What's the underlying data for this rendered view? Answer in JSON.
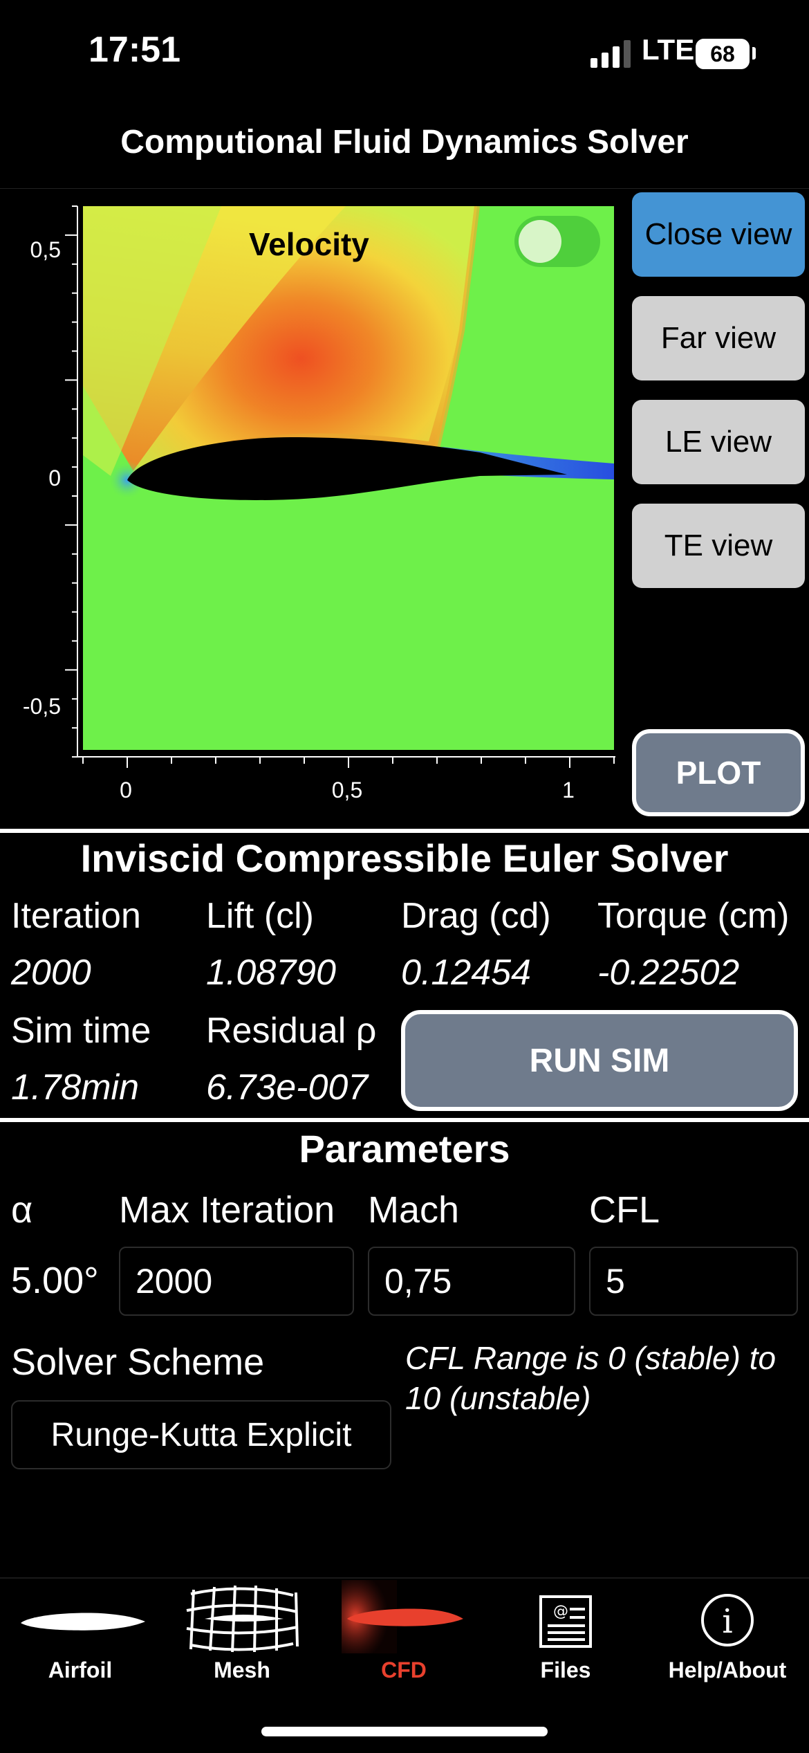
{
  "status": {
    "time": "17:51",
    "network": "LTE",
    "battery": "68"
  },
  "title": "Computional Fluid Dynamics Solver",
  "plot": {
    "label": "Velocity",
    "y_ticks": [
      "0,5",
      "0",
      "-0,5"
    ],
    "x_ticks": [
      "0",
      "0,5",
      "1"
    ],
    "toggle_on": true,
    "colors": {
      "field": "#6ef04a",
      "high": "#ef3b1e",
      "mid": "#f6d52e",
      "low": "#1f3cf0",
      "airfoil": "#000000"
    }
  },
  "view_buttons": [
    {
      "label": "Close view",
      "active": true
    },
    {
      "label": "Far view",
      "active": false
    },
    {
      "label": "LE view",
      "active": false
    },
    {
      "label": "TE view",
      "active": false
    }
  ],
  "plot_button": "PLOT",
  "solver": {
    "title": "Inviscid Compressible Euler Solver",
    "iteration_label": "Iteration",
    "iteration": "2000",
    "lift_label": "Lift (cl)",
    "lift": "1.08790",
    "drag_label": "Drag (cd)",
    "drag": "0.12454",
    "torque_label": "Torque (cm)",
    "torque": "-0.22502",
    "simtime_label": "Sim time",
    "simtime": "1.78min",
    "residual_label": "Residual ρ",
    "residual": "6.73e-007",
    "run_button": "RUN SIM"
  },
  "parameters": {
    "title": "Parameters",
    "alpha_label": "α",
    "alpha": "5.00°",
    "maxiter_label": "Max Iteration",
    "maxiter": "2000",
    "mach_label": "Mach",
    "mach": "0,75",
    "cfl_label": "CFL",
    "cfl": "5",
    "scheme_label": "Solver Scheme",
    "scheme": "Runge-Kutta Explicit",
    "cfl_note": "CFL Range is 0 (stable) to 10 (unstable)"
  },
  "tabs": [
    {
      "label": "Airfoil",
      "icon": "airfoil-icon"
    },
    {
      "label": "Mesh",
      "icon": "mesh-icon"
    },
    {
      "label": "CFD",
      "icon": "cfd-icon",
      "active": true
    },
    {
      "label": "Files",
      "icon": "files-icon"
    },
    {
      "label": "Help/About",
      "icon": "info-icon"
    }
  ],
  "accent": "#e8402d"
}
